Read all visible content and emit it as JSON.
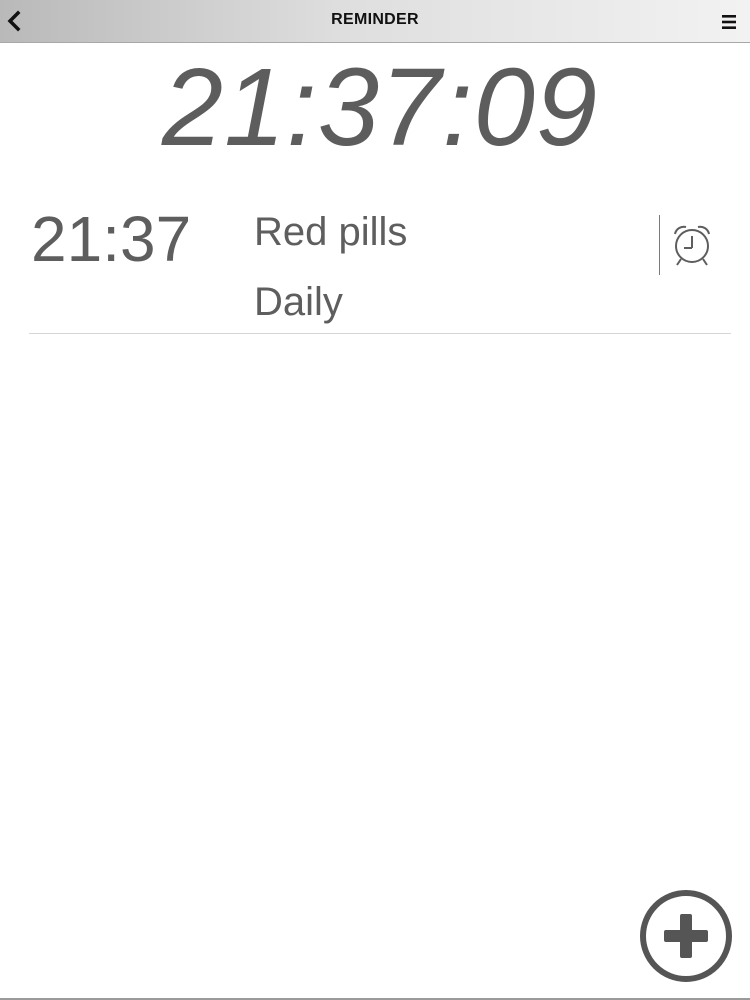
{
  "header": {
    "title": "REMINDER",
    "back_icon": "chevron-left-icon",
    "menu_icon": "hamburger-menu-icon",
    "gradient_colors": [
      "#b9b9b9",
      "#f2f2f2"
    ]
  },
  "clock": {
    "current_time": "21:37:09"
  },
  "reminders": [
    {
      "time": "21:37",
      "name": "Red pills",
      "repeat": "Daily",
      "icon": "alarm-clock-icon"
    }
  ],
  "actions": {
    "add_icon": "plus-circle-icon"
  },
  "colors": {
    "text_gray": "#5e5e5e",
    "title_black": "#111111",
    "background": "#ffffff"
  }
}
